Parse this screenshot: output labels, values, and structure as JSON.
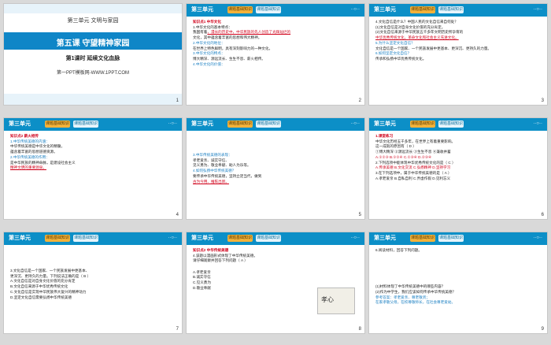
{
  "header": {
    "unit": "第三单元",
    "tab1": "课题基础知识",
    "tab2": "课题基础知识",
    "dots": "··○··"
  },
  "slides": [
    {
      "num": "1",
      "cover_unit": "第三单元  文明与家园",
      "cover_title": "第五课  守望精神家园",
      "cover_sub": "第1课时  延续文化血脉",
      "cover_web": "第一PPT模板网-WWW.1PPT.COM"
    },
    {
      "num": "2",
      "lines": [
        "知识点1  中华文化",
        "1.中华文化的基本特点：",
        "我国有着",
        "，漫长的历史中，中华民族的先人创造了光辉灿烂的",
        "文化，其中蕴含着丰富的思想和伟大精神。",
        "2.中华文化的地位：",
        "在世界上特色鲜明，具有深刻影响力的一种文化。",
        "3.中华文化的特点：",
        "博大精深、源远流长、生生不息、薪火相传。",
        "4.中华文化的价值："
      ]
    },
    {
      "num": "3",
      "lines": [
        "4.文化自信是什么？中国人民的文化自信来自何处？",
        "(1)文化自信是对自身文化价值的充分肯定。",
        "(2)文化自信来源于中华民族五千多年文明历史所孕育的",
        "中华优秀传统文化，革命文化和社会主义先进文化。",
        "5.为什么坚定文化自信？",
        "文化自信是一个国家、一个民族发展中更基本、更深沉、更持久的力量。",
        "6.如何坚定文化自信？",
        "传承和弘扬中华优秀传统文化。"
      ]
    },
    {
      "num": "4",
      "lines": [
        "知识点2  薪火相传",
        "1.中华传统美德的内涵：",
        "中华传统美德是中华文化的精髓，",
        "蕴含着丰富的思想道德资源。",
        "2.中华传统美德的作用：",
        "是中华民族的精神命脉，是建设社会主义",
        "精神文明的重要源泉。"
      ]
    },
    {
      "num": "5",
      "lines": [
        "3.中华传统美德的表现：",
        "孝老爱亲、诚实守信、",
        "见义勇为、敬业奉献、助人为乐等。",
        "4.如何弘扬中华传统美德？",
        "要传承中华传统美德，坚持立足当代，做到",
        "古为今用、推陈出新。"
      ]
    },
    {
      "num": "6",
      "lines": [
        "1.课堂练习",
        "中华文化历经五千多年，在世界上有着重要影响。",
        "这一成就的原因有（  D  ）",
        "①博大精深  ②源远流长  ③生生不息  ④兼收并蓄",
        "A.①②③   B.①②④   C.①③④   D.②③④",
        "2.下列选项中能体现中华优秀传统文化的是（  C  ）",
        "A.传承美德  B.文化交流  C.弘扬精神  D.坚持学习",
        "3.在下列选项中，属于中华传统美德的是（  A  ）",
        "A.孝老爱亲  B.自私自利  C.弄虚作假  D.见利忘义"
      ]
    },
    {
      "num": "7",
      "lines": [
        "3.文化自信是一个国家、一个民族发展中更基本、",
        "更深沉、更持久的力量。下列说法正确的是（ B ）",
        "A.文化自信是对自身文化价值的充分肯定",
        "B.文化自信来源于中华优秀传统文化",
        "C.文化自信是实现中华民族伟大复兴的精神动力",
        "D.坚定文化自信需要弘扬中华传统美德"
      ]
    },
    {
      "num": "8",
      "lines": [
        "知识点2  中华传统美德",
        "4.该题以漫画形式体现了中华传统美德。",
        "请仔细观察并回答下列问题（  A  ）",
        "A.孝老爱亲",
        "B.诚实守信",
        "C.见义勇为",
        "D.敬业奉献"
      ],
      "image_text": "孝心"
    },
    {
      "num": "9",
      "lines": [
        "6.阅读材料，回答下列问题。",
        "(1)材料体现了中华传统美德中的哪些内容？",
        "(2)作为中学生，我们应该如何传承中华传统美德？",
        "参考答案：孝老爱亲、尊老敬贤；",
        "在家孝敬父母，在校尊敬师长，在社会尊老爱幼。"
      ]
    }
  ]
}
